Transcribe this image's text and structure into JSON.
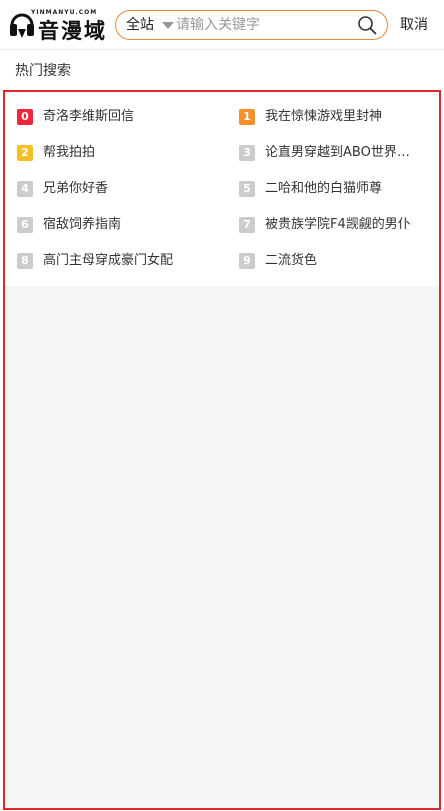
{
  "header": {
    "logo_small": "YINMANYU.COM",
    "logo_text": "音漫域",
    "search_scope": "全站",
    "search_placeholder": "请输入关键字",
    "cancel_label": "取消"
  },
  "hot": {
    "title": "热门搜索",
    "items": [
      {
        "rank": "0",
        "label": "奇洛李维斯回信",
        "color": "#f2243e"
      },
      {
        "rank": "1",
        "label": "我在惊悚游戏里封神",
        "color": "#f7902b"
      },
      {
        "rank": "2",
        "label": "帮我拍拍",
        "color": "#f6c025"
      },
      {
        "rank": "3",
        "label": "论直男穿越到ABO世界…",
        "color": "#cccccc"
      },
      {
        "rank": "4",
        "label": "兄弟你好香",
        "color": "#cccccc"
      },
      {
        "rank": "5",
        "label": "二哈和他的白猫师尊",
        "color": "#cccccc"
      },
      {
        "rank": "6",
        "label": "宿敌饲养指南",
        "color": "#cccccc"
      },
      {
        "rank": "7",
        "label": "被贵族学院F4觊觎的男仆",
        "color": "#cccccc"
      },
      {
        "rank": "8",
        "label": "高门主母穿成豪门女配",
        "color": "#cccccc"
      },
      {
        "rank": "9",
        "label": "二流货色",
        "color": "#cccccc"
      }
    ]
  }
}
